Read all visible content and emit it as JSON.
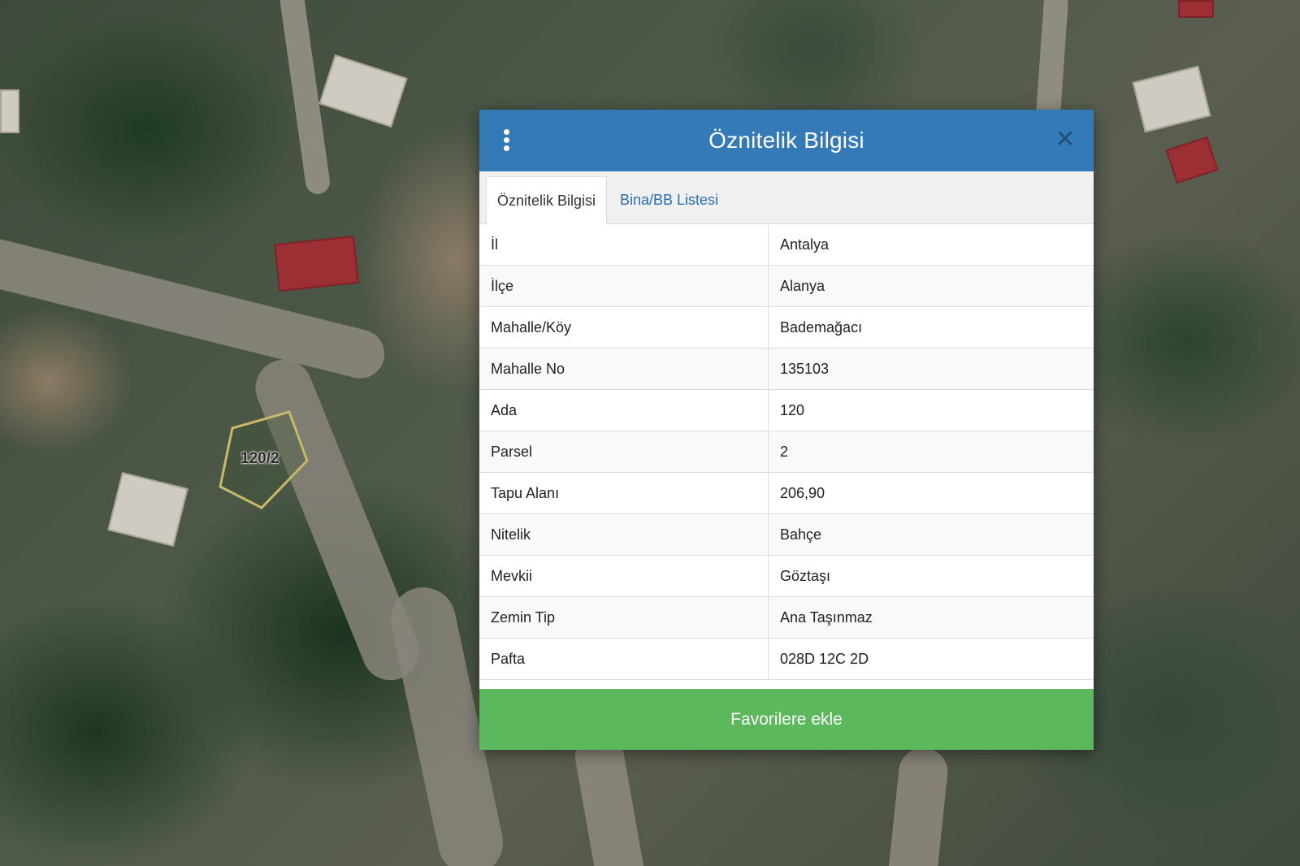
{
  "map": {
    "parcel_label": "120/2"
  },
  "dialog": {
    "title": "Öznitelik Bilgisi",
    "menu_icon": "vertical-ellipsis-icon",
    "close_icon": "close-x-icon",
    "header_color": "#337ab7",
    "tabs": [
      {
        "label": "Öznitelik Bilgisi",
        "active": true
      },
      {
        "label": "Bina/BB Listesi",
        "active": false
      }
    ],
    "rows": [
      {
        "key": "İl",
        "value": "Antalya"
      },
      {
        "key": "İlçe",
        "value": "Alanya"
      },
      {
        "key": "Mahalle/Köy",
        "value": "Bademağacı"
      },
      {
        "key": "Mahalle No",
        "value": "135103"
      },
      {
        "key": "Ada",
        "value": "120"
      },
      {
        "key": "Parsel",
        "value": "2"
      },
      {
        "key": "Tapu Alanı",
        "value": "206,90"
      },
      {
        "key": "Nitelik",
        "value": "Bahçe"
      },
      {
        "key": "Mevkii",
        "value": "Göztaşı"
      },
      {
        "key": "Zemin Tip",
        "value": "Ana Taşınmaz"
      },
      {
        "key": "Pafta",
        "value": "028D 12C 2D"
      }
    ],
    "favorite_button_label": "Favorilere ekle",
    "favorite_button_color": "#5cb85c"
  }
}
